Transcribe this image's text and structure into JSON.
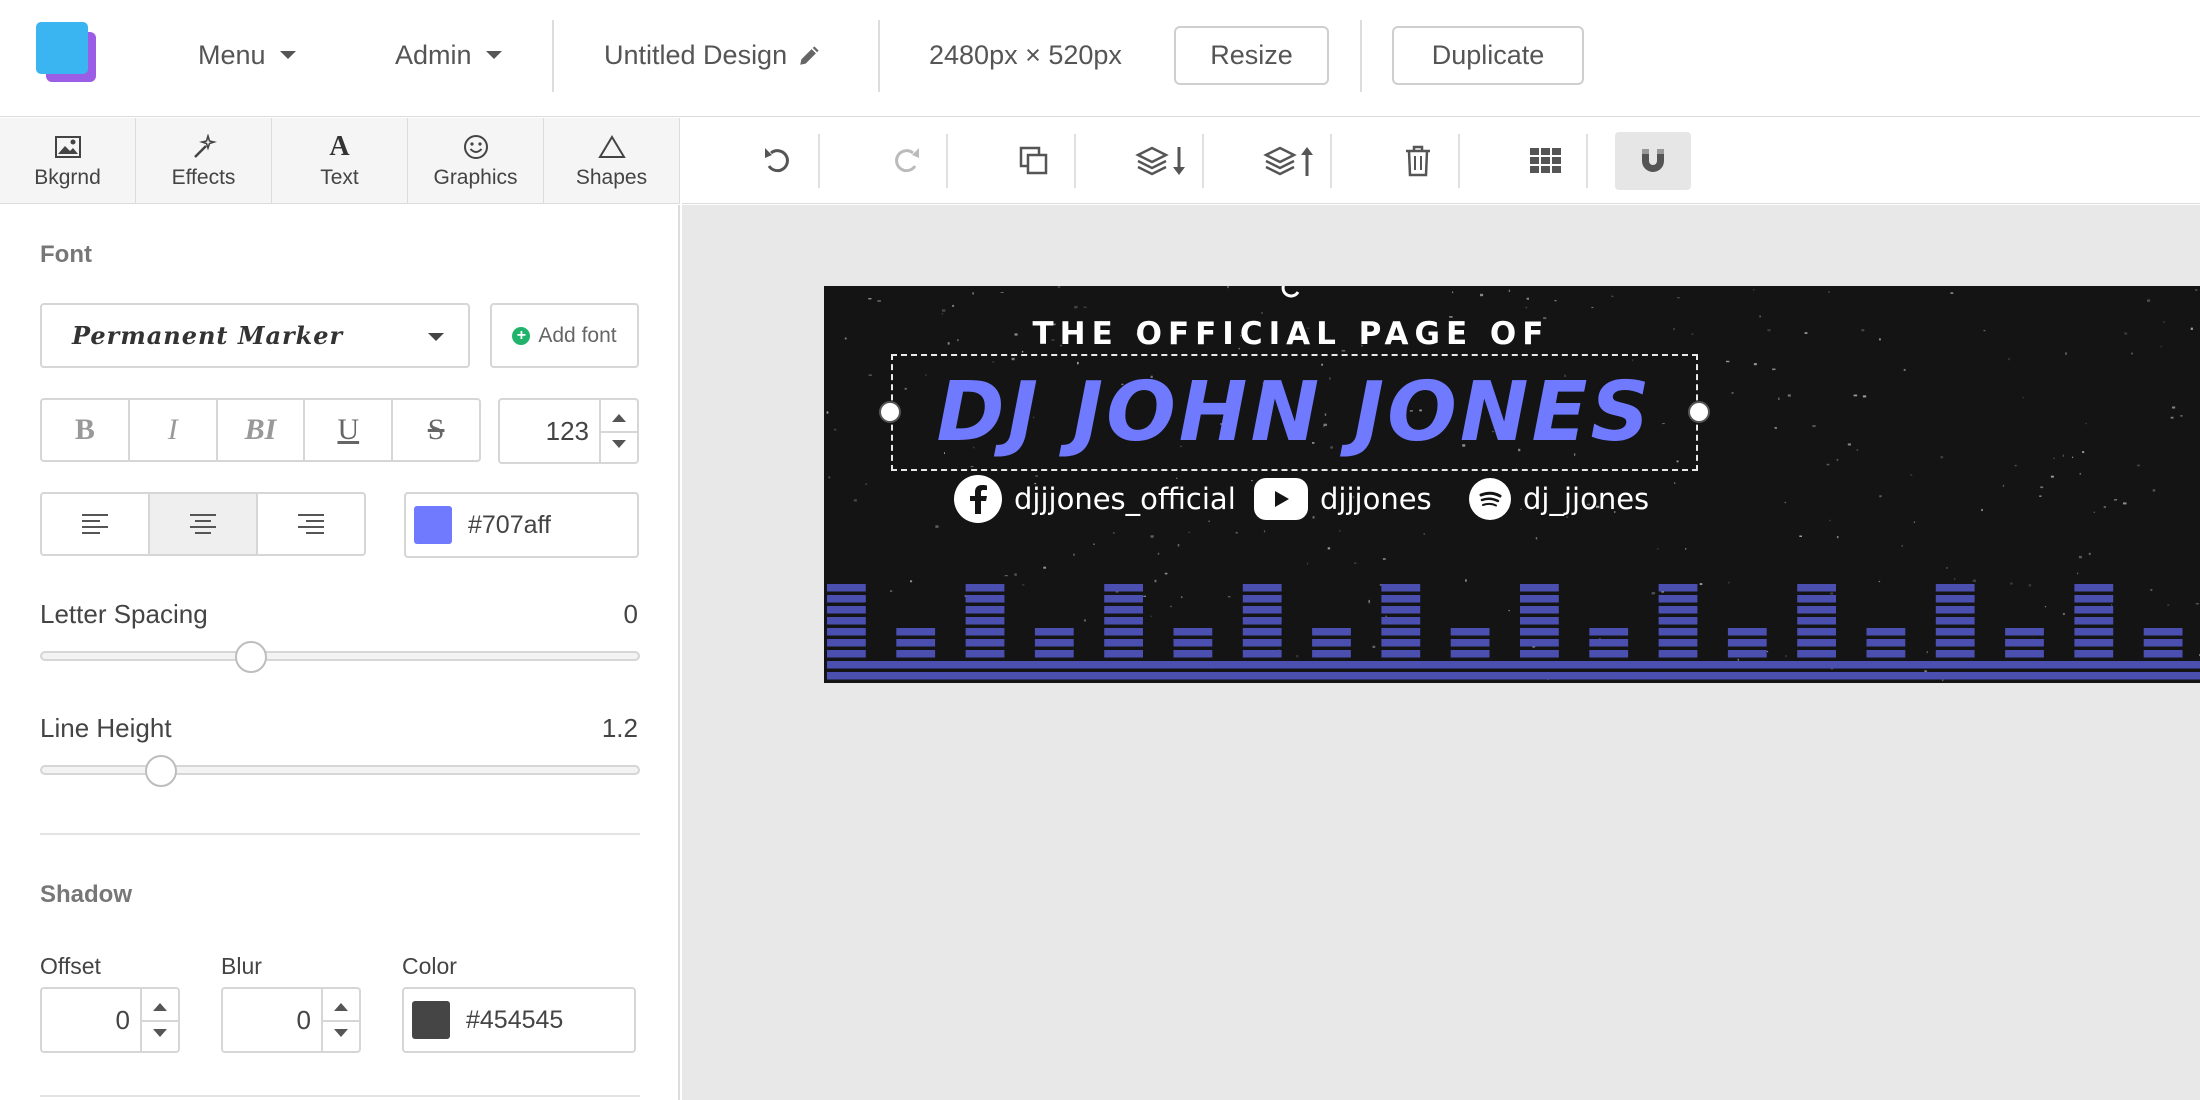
{
  "topbar": {
    "menu_label": "Menu",
    "admin_label": "Admin",
    "design_title": "Untitled Design",
    "dimensions": "2480px × 520px",
    "resize_label": "Resize",
    "duplicate_label": "Duplicate"
  },
  "tabs": [
    {
      "label": "Bkgrnd",
      "icon": "image-icon"
    },
    {
      "label": "Effects",
      "icon": "magic-wand-icon"
    },
    {
      "label": "Text",
      "icon": "text-icon"
    },
    {
      "label": "Graphics",
      "icon": "smiley-icon"
    },
    {
      "label": "Shapes",
      "icon": "triangle-icon"
    }
  ],
  "panel": {
    "font_section": "Font",
    "font_name": "Permanent Marker",
    "add_font_label": "Add font",
    "style_buttons": [
      "B",
      "I",
      "BI",
      "U",
      "S"
    ],
    "font_size": "123",
    "text_color": "#707aff",
    "letter_spacing_label": "Letter Spacing",
    "letter_spacing_value": "0",
    "letter_spacing_fraction": 0.35,
    "line_height_label": "Line Height",
    "line_height_value": "1.2",
    "line_height_fraction": 0.2,
    "shadow_section": "Shadow",
    "offset_label": "Offset",
    "offset_value": "0",
    "blur_label": "Blur",
    "blur_value": "0",
    "shadow_color_label": "Color",
    "shadow_color": "#454545"
  },
  "canvas": {
    "kicker": "THE OFFICIAL PAGE OF",
    "headline": "DJ JOHN JONES",
    "headline_color": "#707aff",
    "background_color": "#141414",
    "eq_color": "#4a4fb0",
    "socials": [
      {
        "icon": "facebook-icon",
        "handle": "djjjones_official"
      },
      {
        "icon": "youtube-icon",
        "handle": "djjjones"
      },
      {
        "icon": "spotify-icon",
        "handle": "dj_jjones"
      }
    ]
  }
}
